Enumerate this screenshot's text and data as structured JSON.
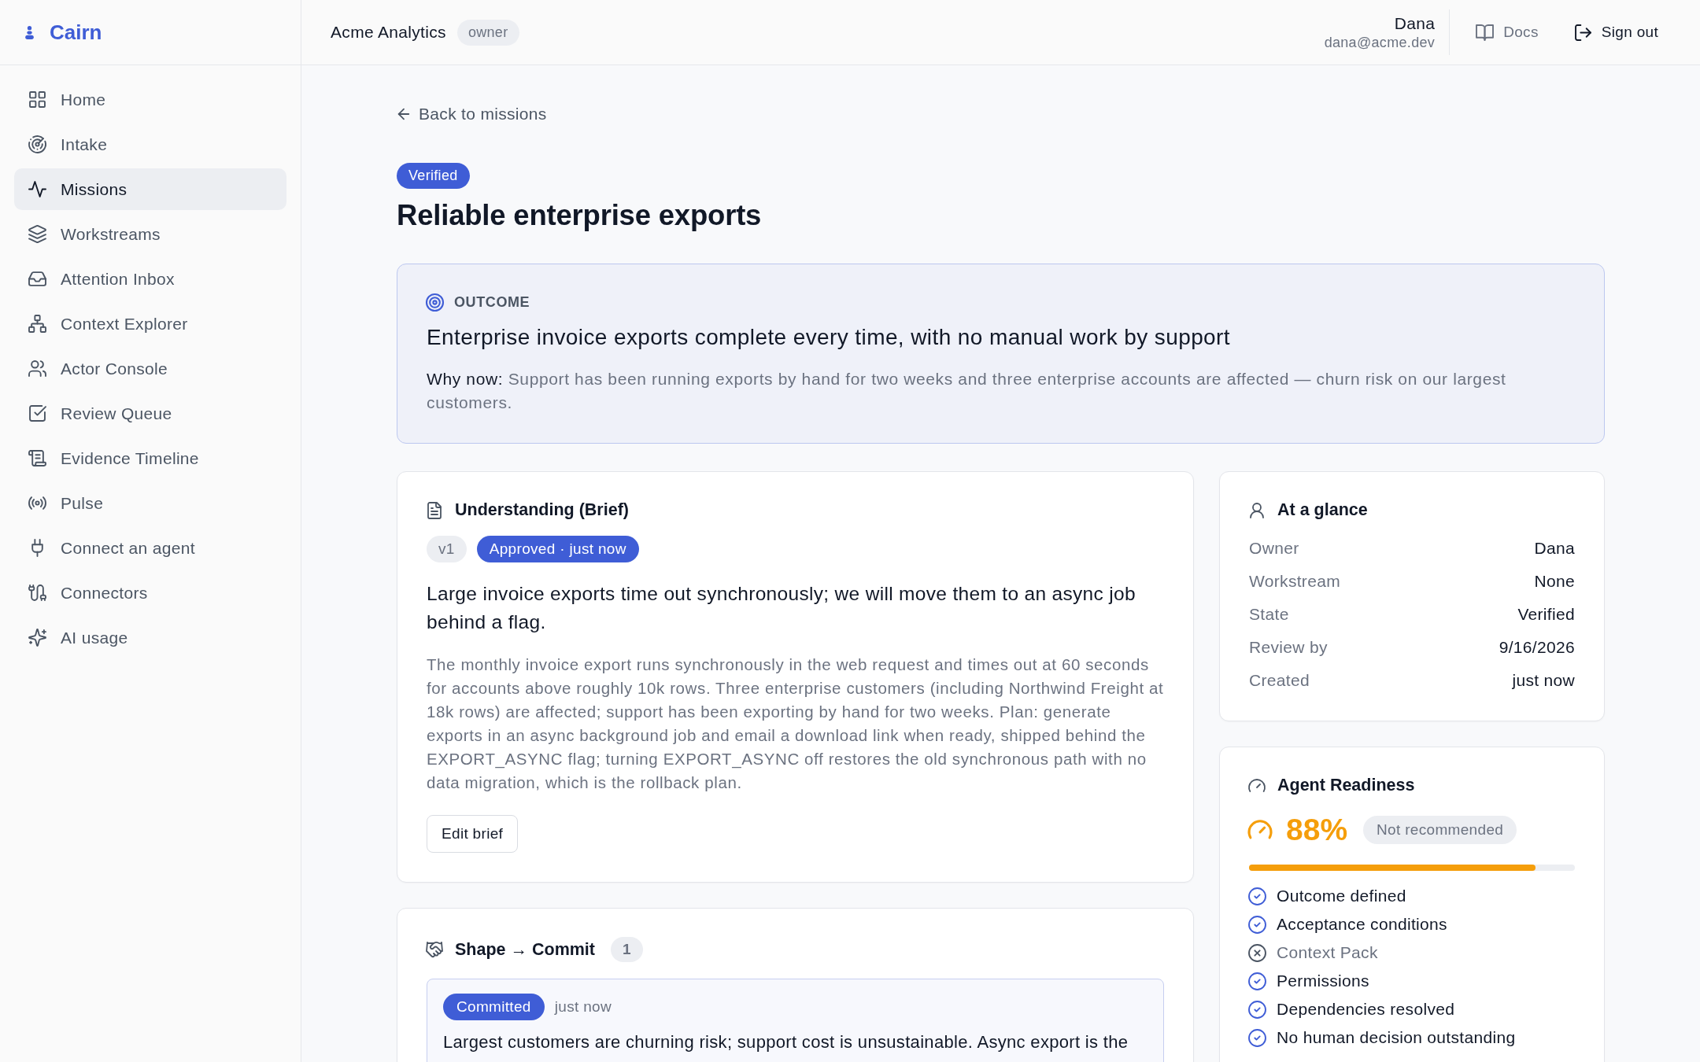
{
  "sidebar": {
    "brand": "Cairn",
    "items": [
      {
        "label": "Home",
        "selected": false
      },
      {
        "label": "Intake",
        "selected": false
      },
      {
        "label": "Missions",
        "selected": true
      },
      {
        "label": "Workstreams",
        "selected": false
      },
      {
        "label": "Attention Inbox",
        "selected": false
      },
      {
        "label": "Context Explorer",
        "selected": false
      },
      {
        "label": "Actor Console",
        "selected": false
      },
      {
        "label": "Review Queue",
        "selected": false
      },
      {
        "label": "Evidence Timeline",
        "selected": false
      },
      {
        "label": "Pulse",
        "selected": false
      },
      {
        "label": "Connect an agent",
        "selected": false
      },
      {
        "label": "Connectors",
        "selected": false
      },
      {
        "label": "AI usage",
        "selected": false
      }
    ]
  },
  "header": {
    "workspace": "Acme Analytics",
    "role_badge": "owner",
    "user": {
      "name": "Dana",
      "email": "dana@acme.dev"
    },
    "docs_link": "Docs",
    "sign_out_button": "Sign out"
  },
  "mission": {
    "back_link": "Back to missions",
    "status_badge": "Verified",
    "title": "Reliable enterprise exports"
  },
  "outcome": {
    "label": "OUTCOME",
    "statement": "Enterprise invoice exports complete every time, with no manual work by support",
    "why_now_label": "Why now:",
    "why_now": "Support has been running exports by hand for two weeks and three enterprise accounts are affected — churn risk on our largest customers."
  },
  "brief": {
    "title": "Understanding (Brief)",
    "version": "v1",
    "approval": "Approved · just now",
    "summary": "Large invoice exports time out synchronously; we will move them to an async job behind a flag.",
    "details": "The monthly invoice export runs synchronously in the web request and times out at 60 seconds for accounts above roughly 10k rows. Three enterprise customers (including Northwind Freight at 18k rows) are affected; support has been exporting by hand for two weeks. Plan: generate exports in an async background job and email a download link when ready, shipped behind the EXPORT_ASYNC flag; turning EXPORT_ASYNC off restores the old synchronous path with no data migration, which is the rollback plan.",
    "edit_button": "Edit brief"
  },
  "shape_commit": {
    "title": "Shape → Commit",
    "count": "1",
    "entries": [
      {
        "status": "Committed",
        "time": "just now",
        "text": "Largest customers are churning risk; support cost is unsustainable. Async export is the"
      }
    ]
  },
  "at_a_glance": {
    "title": "At a glance",
    "rows": [
      {
        "label": "Owner",
        "value": "Dana"
      },
      {
        "label": "Workstream",
        "value": "None"
      },
      {
        "label": "State",
        "value": "Verified"
      },
      {
        "label": "Review by",
        "value": "9/16/2026"
      },
      {
        "label": "Created",
        "value": "just now"
      }
    ]
  },
  "agent_readiness": {
    "title": "Agent Readiness",
    "score": "88%",
    "recommendation": "Not recommended",
    "level": 0.88,
    "checks": [
      {
        "label": "Outcome defined",
        "done": true
      },
      {
        "label": "Acceptance conditions",
        "done": true
      },
      {
        "label": "Context Pack",
        "done": false
      },
      {
        "label": "Permissions",
        "done": true
      },
      {
        "label": "Dependencies resolved",
        "done": true
      },
      {
        "label": "No human decision outstanding",
        "done": true
      }
    ]
  }
}
